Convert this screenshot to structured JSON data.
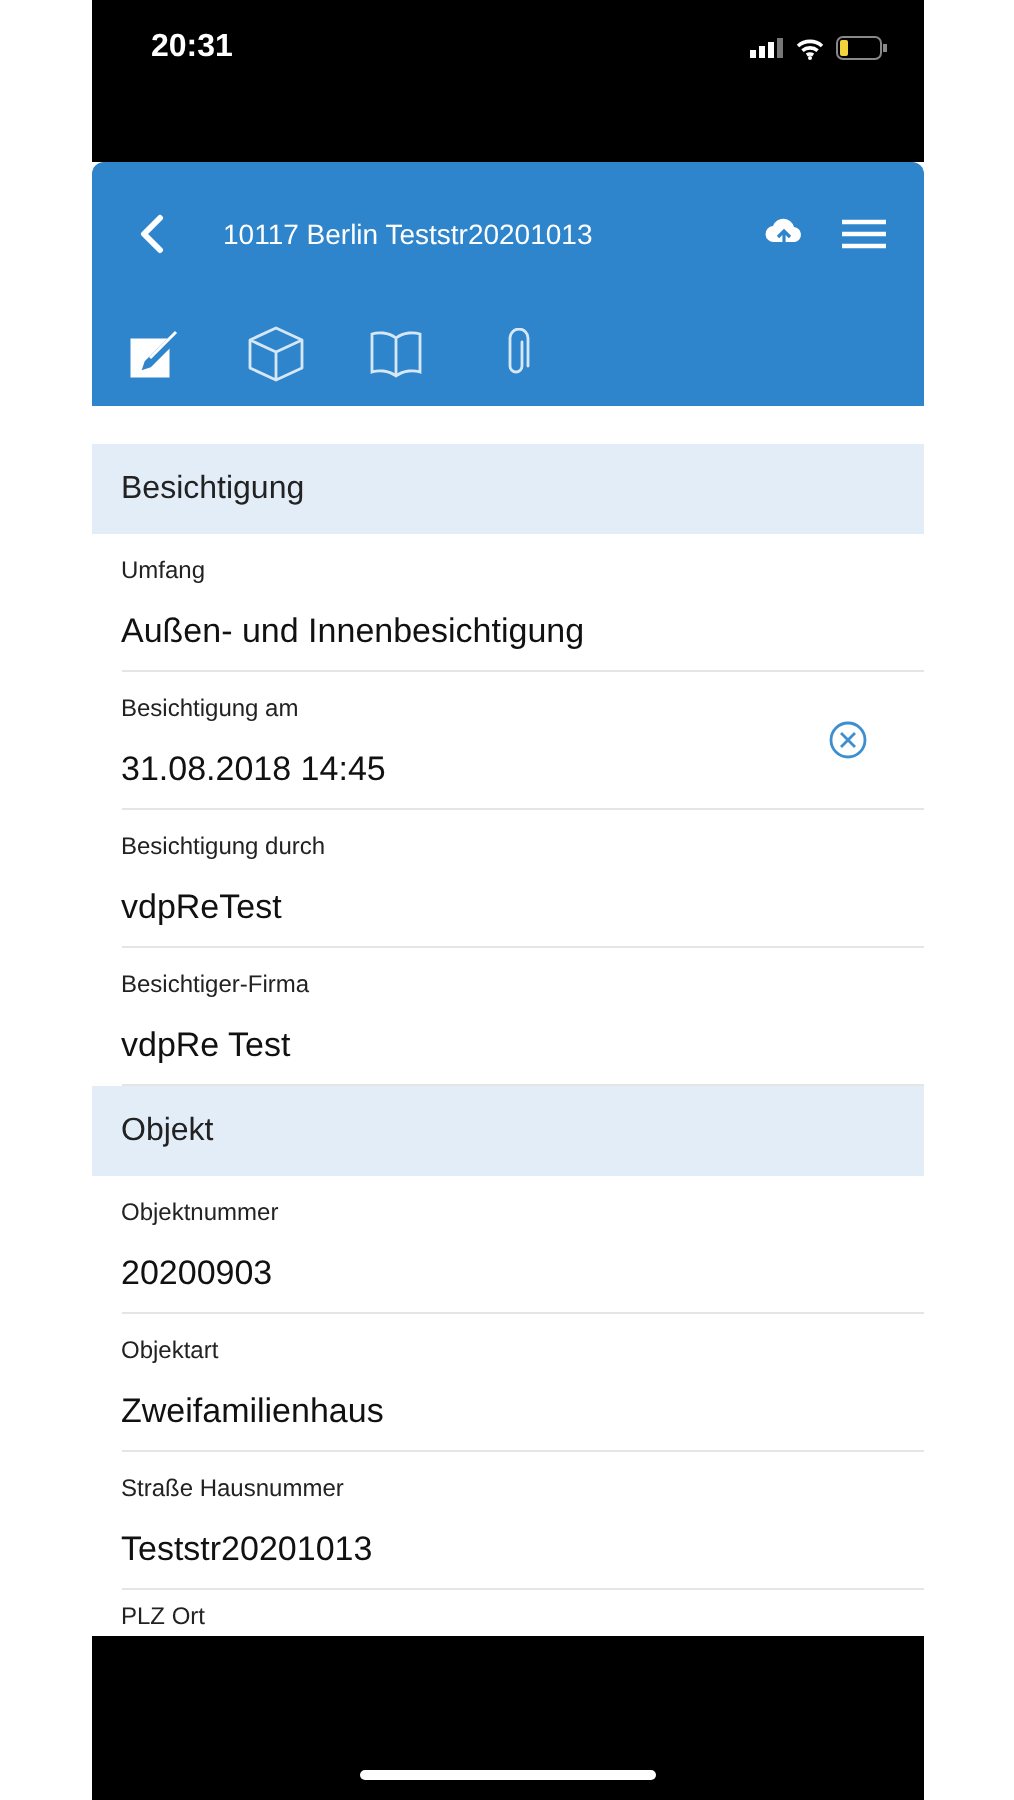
{
  "status_bar": {
    "time": "20:31"
  },
  "header": {
    "title": "10117 Berlin Teststr20201013"
  },
  "tabs": [
    {
      "kind": "edit",
      "selected": true
    },
    {
      "kind": "cube",
      "selected": false
    },
    {
      "kind": "book",
      "selected": false
    },
    {
      "kind": "attachment",
      "selected": false
    }
  ],
  "sections": [
    {
      "title": "Besichtigung",
      "fields": [
        {
          "label": "Umfang",
          "value": "Außen- und Innenbesichtigung",
          "clearable": false
        },
        {
          "label": "Besichtigung am",
          "value": "31.08.2018 14:45",
          "clearable": true
        },
        {
          "label": "Besichtigung durch",
          "value": "vdpReTest",
          "clearable": false
        },
        {
          "label": "Besichtiger-Firma",
          "value": "vdpRe Test",
          "clearable": false
        }
      ]
    },
    {
      "title": "Objekt",
      "fields": [
        {
          "label": "Objektnummer",
          "value": "20200903",
          "clearable": false
        },
        {
          "label": "Objektart",
          "value": "Zweifamilienhaus",
          "clearable": false
        },
        {
          "label": "Straße Hausnummer",
          "value": "Teststr20201013",
          "clearable": false
        },
        {
          "label": "PLZ Ort",
          "clearable": false
        }
      ]
    }
  ]
}
